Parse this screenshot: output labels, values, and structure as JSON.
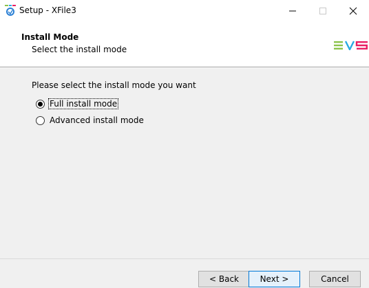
{
  "window": {
    "title": "Setup - XFile3",
    "controls": {
      "minimize_icon": "minimize-icon",
      "maximize_icon": "maximize-icon",
      "close_icon": "close-icon"
    }
  },
  "header": {
    "title": "Install Mode",
    "subtitle": "Select the install mode",
    "logo_text": "EVS",
    "logo_colors": [
      "#8bc34a",
      "#29abe2",
      "#e91e63"
    ]
  },
  "content": {
    "prompt": "Please select the install mode you want",
    "options": [
      {
        "label": "Full install mode",
        "checked": true
      },
      {
        "label": "Advanced install mode",
        "checked": false
      }
    ]
  },
  "footer": {
    "back_label": "< Back",
    "next_label": "Next >",
    "cancel_label": "Cancel"
  }
}
